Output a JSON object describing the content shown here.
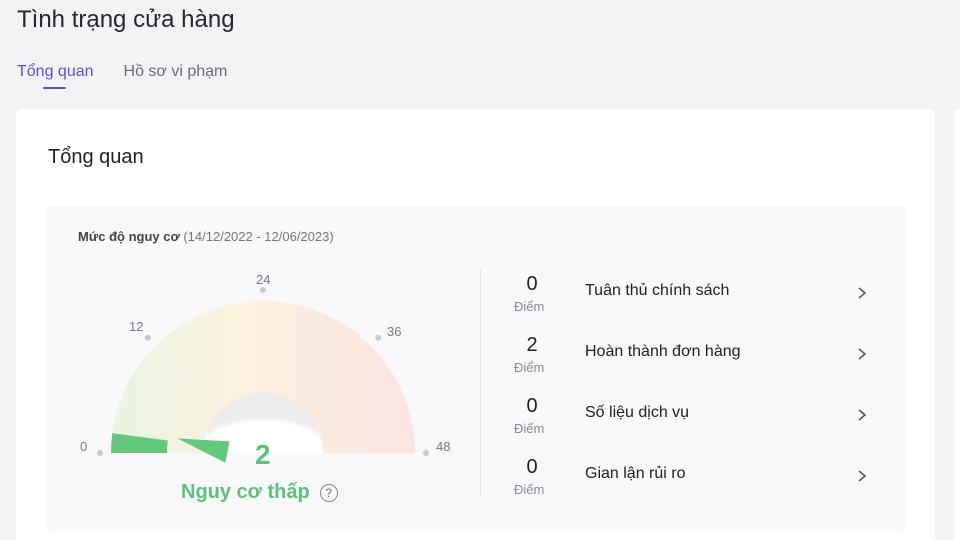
{
  "page": {
    "title": "Tình trạng cửa hàng"
  },
  "tabs": [
    {
      "label": "Tổng quan",
      "active": true
    },
    {
      "label": "Hồ sơ vi phạm",
      "active": false
    }
  ],
  "overview": {
    "title": "Tổng quan",
    "risk": {
      "label": "Mức độ nguy cơ",
      "range": "(14/12/2022 - 12/06/2023)",
      "scale_min": 0,
      "scale_max": 48,
      "ticks": [
        "0",
        "12",
        "24",
        "36",
        "48"
      ],
      "score": "2",
      "score_value": 2,
      "level": "Nguy cơ thấp",
      "level_color": "#5cc27a"
    },
    "metrics": [
      {
        "value": "0",
        "unit": "Điểm",
        "name": "Tuân thủ chính sách"
      },
      {
        "value": "2",
        "unit": "Điểm",
        "name": "Hoàn thành đơn hàng"
      },
      {
        "value": "0",
        "unit": "Điểm",
        "name": "Số liệu dịch vụ"
      },
      {
        "value": "0",
        "unit": "Điểm",
        "name": "Gian lận rủi ro"
      }
    ]
  },
  "colors": {
    "accent": "#5b4fc9",
    "good": "#5cc27a"
  }
}
